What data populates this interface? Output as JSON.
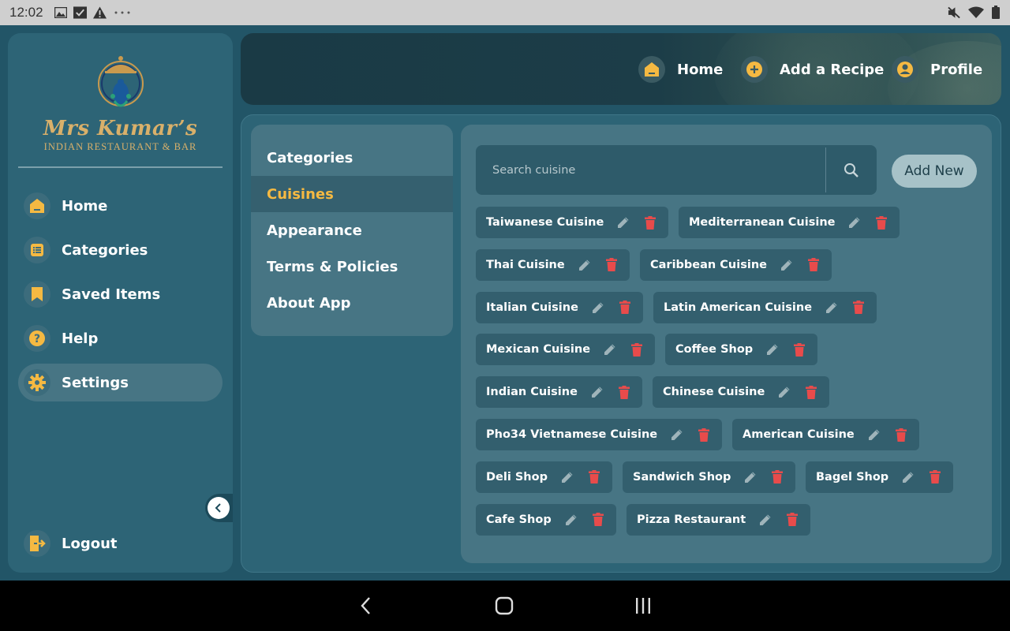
{
  "status_bar": {
    "time": "12:02",
    "icons_left": [
      "image-icon",
      "check-box-icon",
      "warning-icon",
      "more-icon"
    ],
    "icons_right": [
      "mute-icon",
      "wifi-icon",
      "battery-icon"
    ]
  },
  "brand": {
    "name": "Mrs Kumar’s",
    "subtitle": "INDIAN RESTAURANT & BAR"
  },
  "sidebar": {
    "items": [
      {
        "label": "Home",
        "icon": "home-icon"
      },
      {
        "label": "Categories",
        "icon": "list-icon"
      },
      {
        "label": "Saved Items",
        "icon": "bookmark-icon"
      },
      {
        "label": "Help",
        "icon": "help-icon"
      },
      {
        "label": "Settings",
        "icon": "gear-icon",
        "active": true
      }
    ],
    "logout": "Logout"
  },
  "header": {
    "nav": [
      {
        "label": "Home",
        "icon": "home-icon"
      },
      {
        "label": "Add a Recipe",
        "icon": "add-icon"
      },
      {
        "label": "Profile",
        "icon": "profile-icon"
      }
    ]
  },
  "settings_menu": {
    "items": [
      "Categories",
      "Cuisines",
      "Appearance",
      "Terms & Policies",
      "About App"
    ],
    "active": "Cuisines"
  },
  "cuisines": {
    "search_placeholder": "Search cuisine",
    "add_new_label": "Add New",
    "rows": [
      [
        "Taiwanese Cuisine",
        "Mediterranean Cuisine"
      ],
      [
        "Thai Cuisine",
        "Caribbean Cuisine"
      ],
      [
        "Italian Cuisine",
        "Latin American Cuisine"
      ],
      [
        "Mexican Cuisine",
        "Coffee Shop"
      ],
      [
        "Indian Cuisine",
        "Chinese Cuisine"
      ],
      [
        "Pho34 Vietnamese Cuisine",
        "American Cuisine"
      ],
      [
        "Deli Shop",
        "Sandwich Shop",
        "Bagel Shop"
      ],
      [
        "Cafe Shop",
        "Pizza Restaurant"
      ]
    ]
  },
  "colors": {
    "accent": "#f5b942",
    "delete": "#e84b4b",
    "panel": "#2d6476",
    "card": "#477584"
  }
}
